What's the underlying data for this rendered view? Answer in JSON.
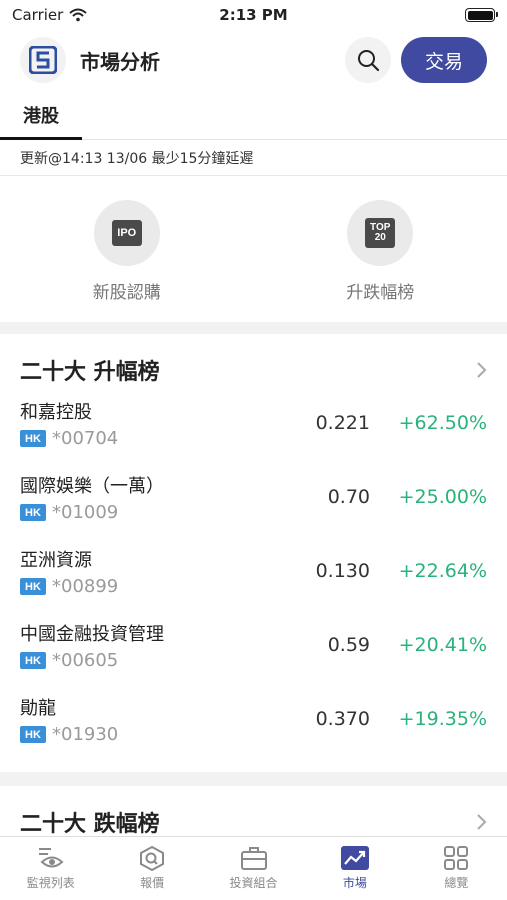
{
  "status_bar": {
    "carrier": "Carrier",
    "time": "2:13 PM"
  },
  "header": {
    "title": "市場分析",
    "trade_label": "交易"
  },
  "tabs": [
    {
      "label": "港股"
    }
  ],
  "update_text": "更新@14:13 13/06 最少15分鐘延遲",
  "shortcuts": [
    {
      "label": "新股認購",
      "badge": "IPO"
    },
    {
      "label": "升跌幅榜",
      "badge_top": "TOP",
      "badge_bottom": "20"
    }
  ],
  "gainers": {
    "title": "二十大 升幅榜",
    "rows": [
      {
        "name": "和嘉控股",
        "tag": "HK",
        "code": "*00704",
        "price": "0.221",
        "change": "+62.50%"
      },
      {
        "name": "國際娛樂（一萬）",
        "tag": "HK",
        "code": "*01009",
        "price": "0.70",
        "change": "+25.00%"
      },
      {
        "name": "亞洲資源",
        "tag": "HK",
        "code": "*00899",
        "price": "0.130",
        "change": "+22.64%"
      },
      {
        "name": "中國金融投資管理",
        "tag": "HK",
        "code": "*00605",
        "price": "0.59",
        "change": "+20.41%"
      },
      {
        "name": "勛龍",
        "tag": "HK",
        "code": "*01930",
        "price": "0.370",
        "change": "+19.35%"
      }
    ]
  },
  "losers": {
    "title": "二十大 跌幅榜"
  },
  "bottom_nav": [
    {
      "label": "監視列表",
      "icon": "watchlist-icon",
      "active": false
    },
    {
      "label": "報價",
      "icon": "quote-icon",
      "active": false
    },
    {
      "label": "投資組合",
      "icon": "portfolio-icon",
      "active": false
    },
    {
      "label": "市場",
      "icon": "market-icon",
      "active": true
    },
    {
      "label": "總覽",
      "icon": "overview-icon",
      "active": false
    }
  ],
  "colors": {
    "accent": "#3f4aa0",
    "gain": "#2ab27b",
    "hk_tag": "#3a8fd9"
  }
}
